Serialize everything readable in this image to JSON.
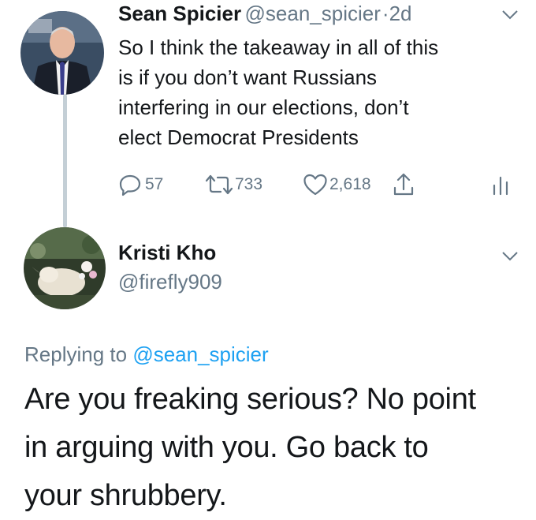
{
  "tweet1": {
    "name": "Sean Spicier",
    "handle": "@sean_spicier",
    "separator": "·",
    "time": "2d",
    "text_lines": [
      "So I think the takeaway in all of this",
      "is if you don’t want Russians",
      "interfering in our elections, don’t",
      "elect Democrat Presidents"
    ],
    "replies": "57",
    "retweets": "733",
    "likes": "2,618"
  },
  "tweet2": {
    "name": "Kristi Kho",
    "handle": "@firefly909",
    "replying_prefix": "Replying to",
    "replying_to": "@sean_spicier",
    "text_lines": [
      "Are you freaking serious? No point",
      "in arguing with you. Go back to",
      "your shrubbery."
    ]
  },
  "colors": {
    "text": "#14171a",
    "secondary": "#657786",
    "link": "#1da1f2",
    "thread_line": "#c4cfd6"
  },
  "icons": [
    "chevron-down-icon",
    "reply-icon",
    "retweet-icon",
    "heart-icon",
    "share-icon",
    "analytics-icon"
  ]
}
